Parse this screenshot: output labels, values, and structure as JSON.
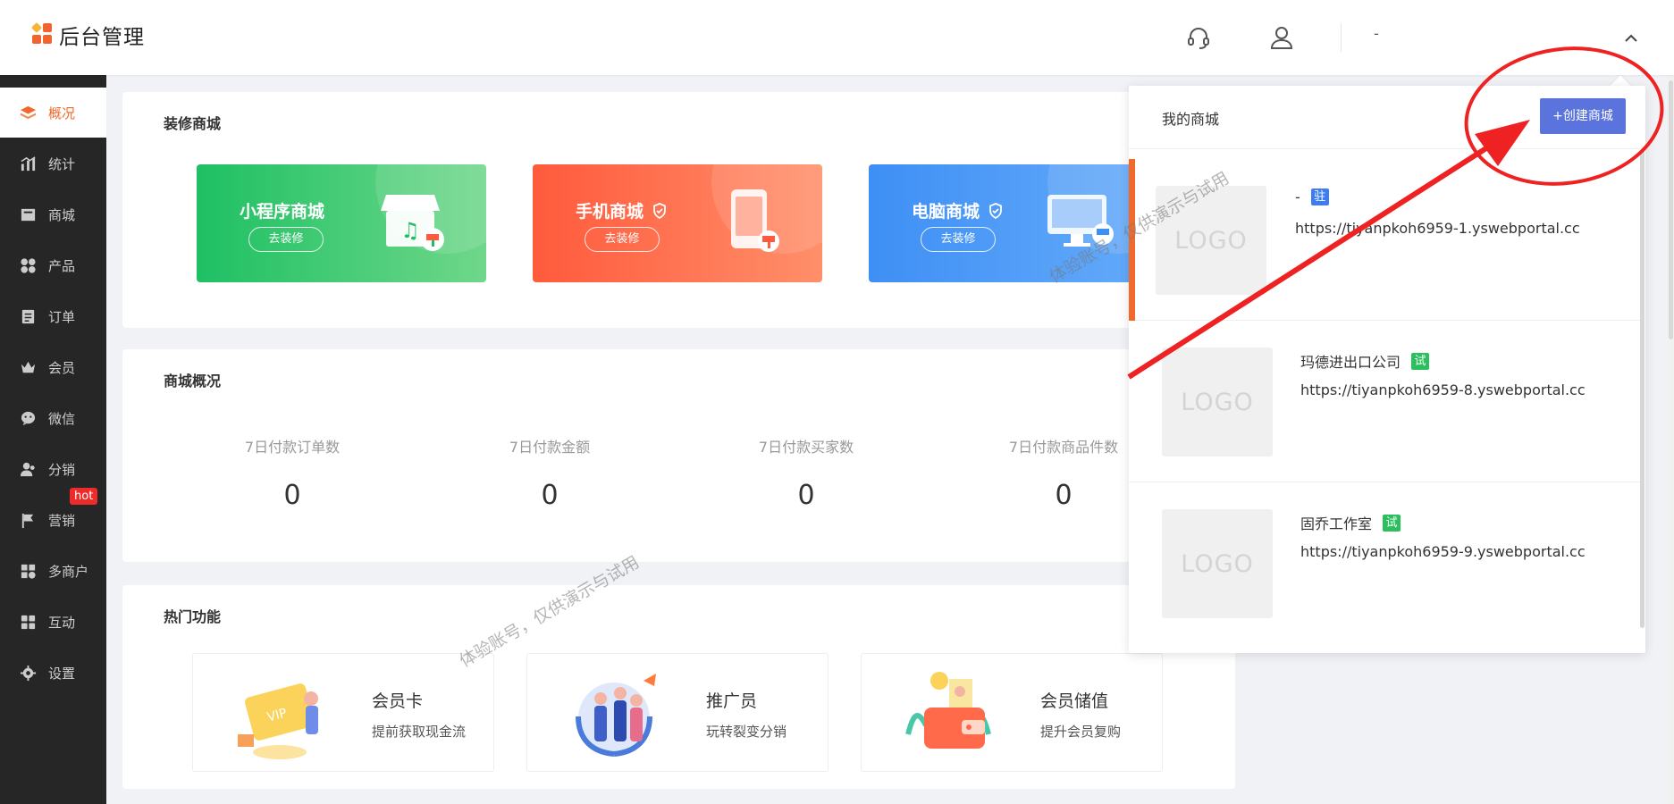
{
  "header": {
    "logo_text": "后台管理",
    "user_name": "-"
  },
  "sidebar": {
    "items": [
      {
        "label": "概况",
        "icon": "layers-icon",
        "active": true
      },
      {
        "label": "统计",
        "icon": "chart-icon"
      },
      {
        "label": "商城",
        "icon": "store-icon"
      },
      {
        "label": "产品",
        "icon": "grid-icon"
      },
      {
        "label": "订单",
        "icon": "order-icon"
      },
      {
        "label": "会员",
        "icon": "crown-icon"
      },
      {
        "label": "微信",
        "icon": "wechat-icon"
      },
      {
        "label": "分销",
        "icon": "users-icon"
      },
      {
        "label": "营销",
        "icon": "flag-icon",
        "badge": "hot"
      },
      {
        "label": "多商户",
        "icon": "multi-store-icon"
      },
      {
        "label": "互动",
        "icon": "interact-icon"
      },
      {
        "label": "设置",
        "icon": "gear-icon"
      }
    ]
  },
  "decorate": {
    "title": "装修商城",
    "banners": [
      {
        "name": "小程序商城",
        "button": "去装修",
        "color_from": "#1ec063",
        "color_to": "#6fd78a"
      },
      {
        "name": "手机商城",
        "button": "去装修",
        "color_from": "#ff5a3c",
        "color_to": "#ff8f6a"
      },
      {
        "name": "电脑商城",
        "button": "去装修",
        "color_from": "#3e8ff5",
        "color_to": "#6fb2fb"
      }
    ]
  },
  "overview": {
    "title": "商城概况",
    "stats": [
      {
        "label": "7日付款订单数",
        "value": "0"
      },
      {
        "label": "7日付款金额",
        "value": "0"
      },
      {
        "label": "7日付款买家数",
        "value": "0"
      },
      {
        "label": "7日付款商品件数",
        "value": "0"
      }
    ]
  },
  "hot": {
    "title": "热门功能",
    "features": [
      {
        "name": "会员卡",
        "desc": "提前获取现金流"
      },
      {
        "name": "推广员",
        "desc": "玩转裂变分销"
      },
      {
        "name": "会员储值",
        "desc": "提升会员复购"
      }
    ]
  },
  "watermark": "体验账号，仅供演示与试用",
  "dropdown": {
    "title": "我的商城",
    "create_button": "+创建商城",
    "logo_placeholder": "LOGO",
    "shops": [
      {
        "name": "-",
        "tag": "驻",
        "tag_color": "#3e7cf0",
        "url": "https://tiyanpkoh6959-1.yswebportal.cc",
        "selected": true
      },
      {
        "name": "玛德进出口公司",
        "tag": "试",
        "tag_color": "#2bbf5e",
        "url": "https://tiyanpkoh6959-8.yswebportal.cc"
      },
      {
        "name": "固乔工作室",
        "tag": "试",
        "tag_color": "#2bbf5e",
        "url": "https://tiyanpkoh6959-9.yswebportal.cc"
      }
    ]
  },
  "annotation_color": "#ee2222"
}
